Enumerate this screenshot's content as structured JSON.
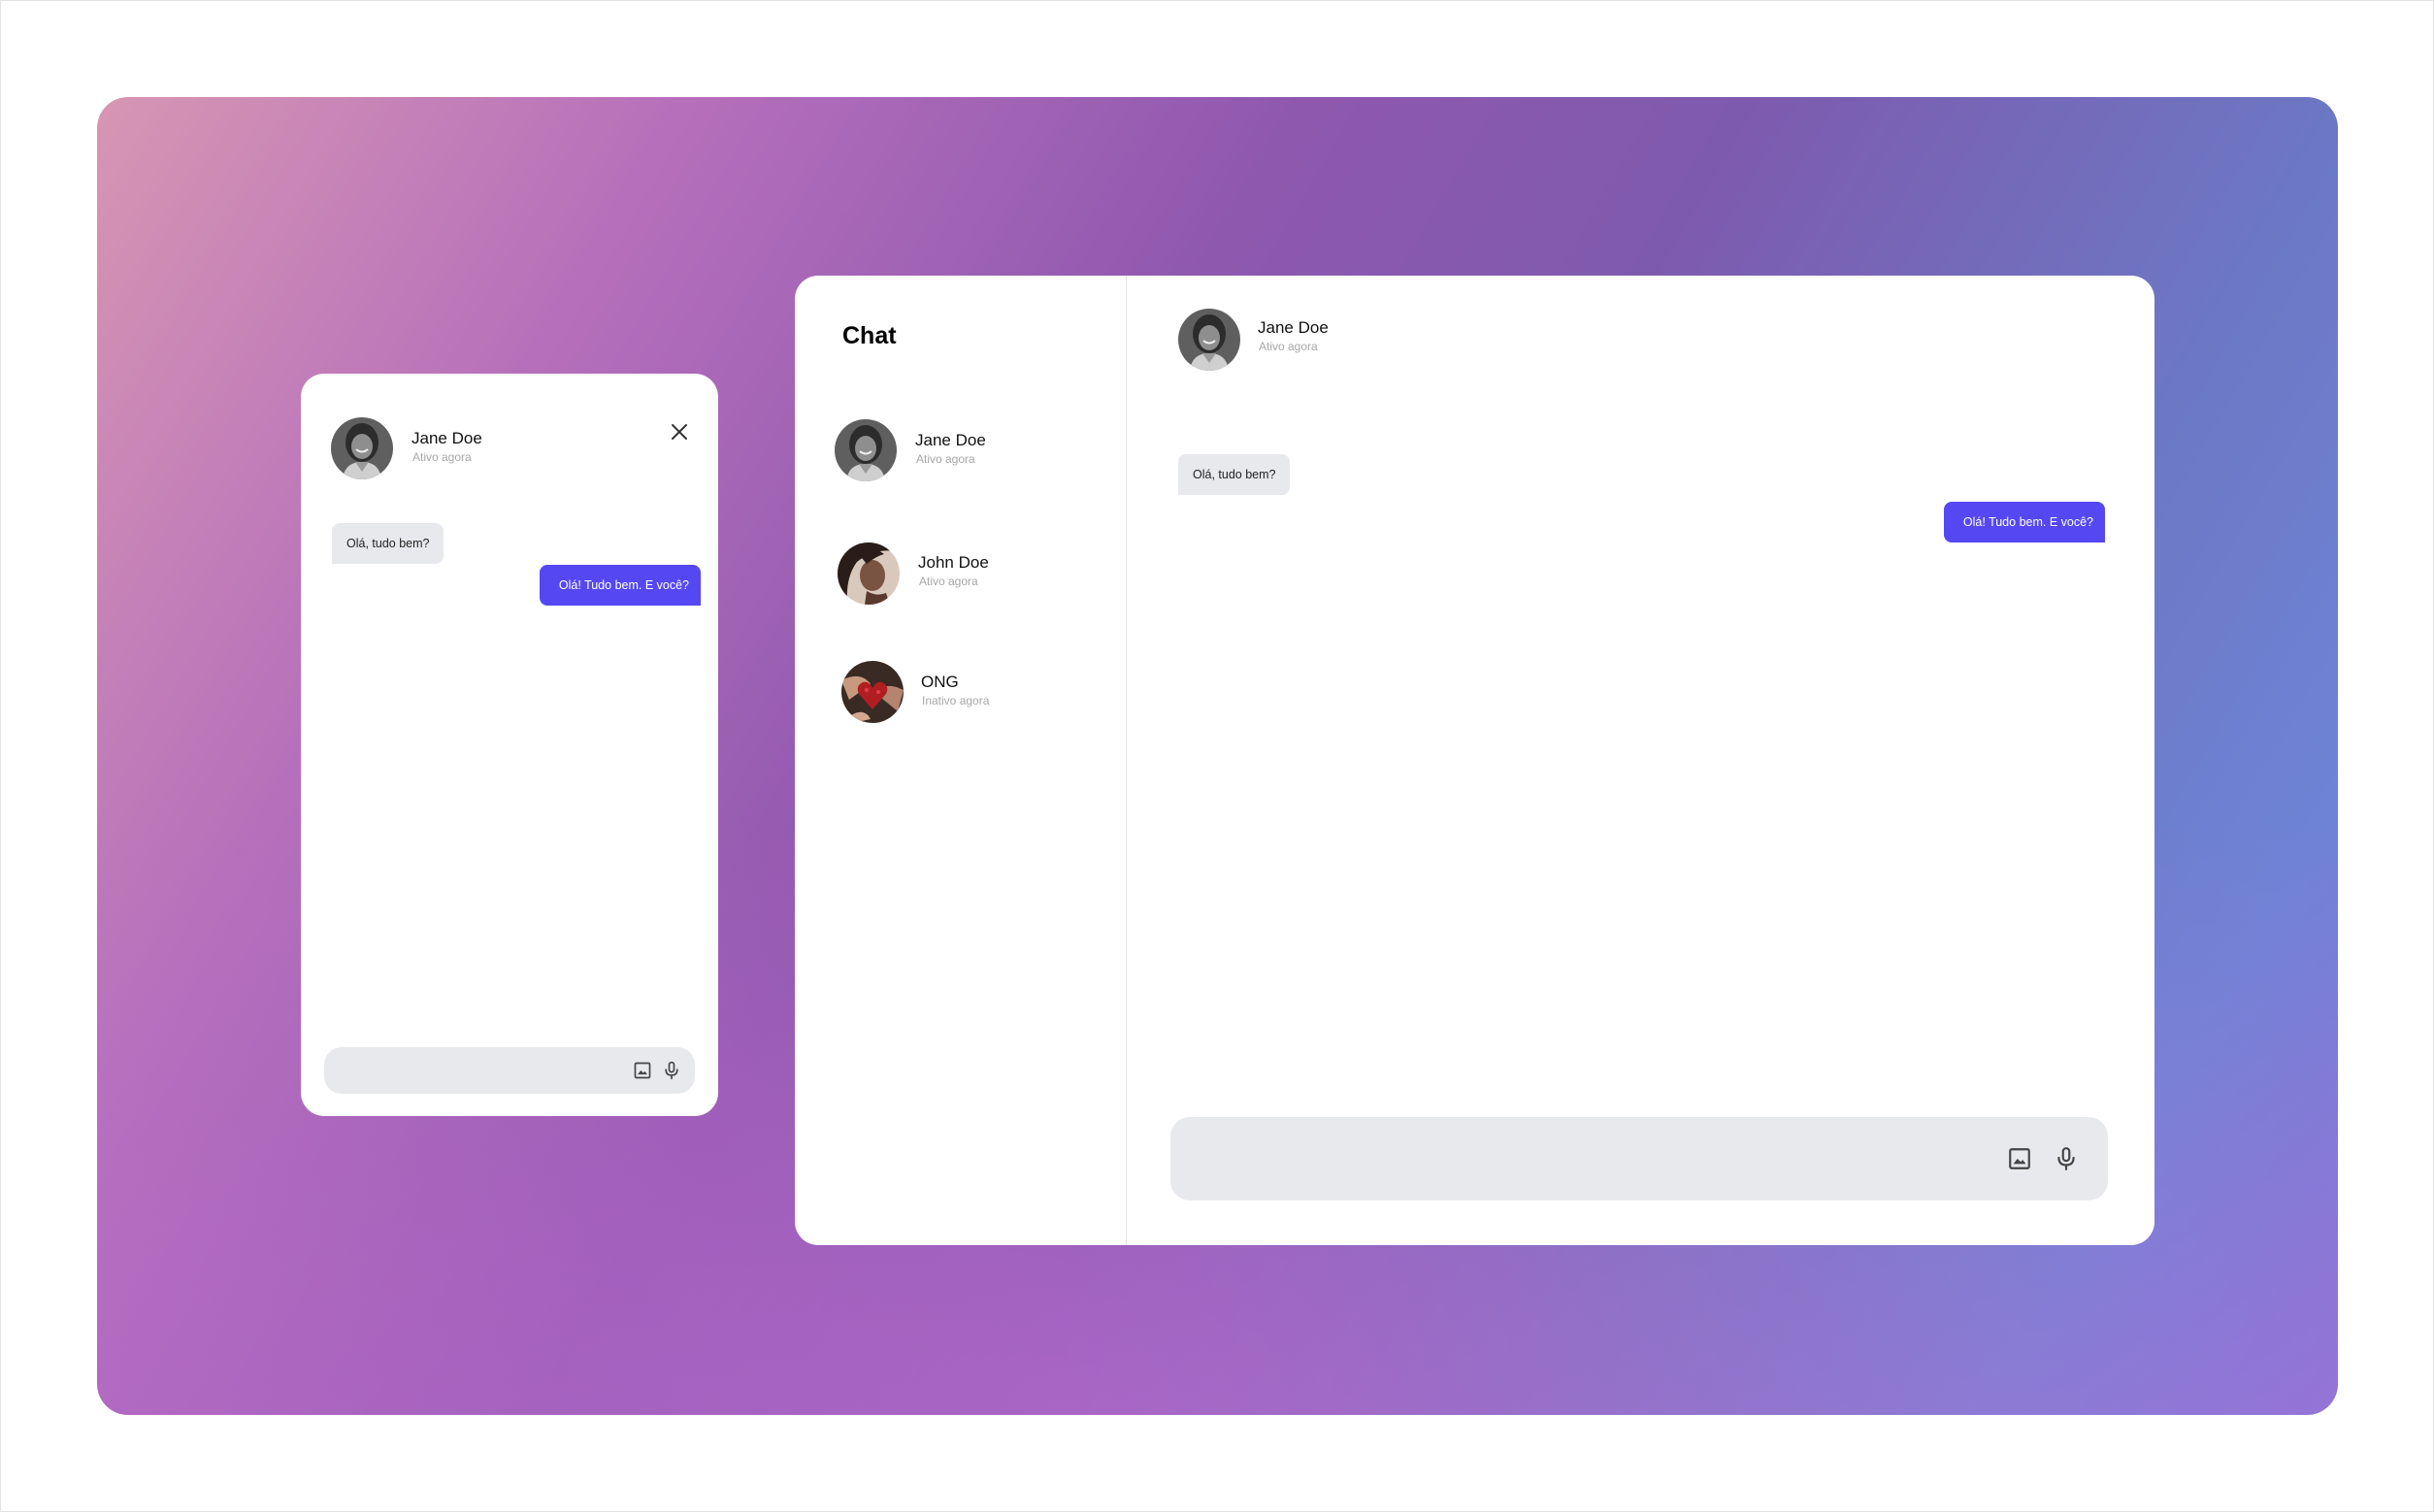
{
  "widget": {
    "contact_name": "Jane Doe",
    "contact_status": "Ativo agora",
    "messages": [
      {
        "direction": "incoming",
        "text": "Olá, tudo bem?"
      },
      {
        "direction": "outgoing",
        "text": "Olá! Tudo bem. E você?"
      }
    ],
    "input_value": "",
    "icons": {
      "close": "close-icon",
      "image": "image-icon",
      "mic": "microphone-icon"
    }
  },
  "sidebar": {
    "title": "Chat",
    "contacts": [
      {
        "name": "Jane Doe",
        "status": "Ativo agora",
        "avatar": "avatar-woman-smiling"
      },
      {
        "name": "John Doe",
        "status": "Ativo agora",
        "avatar": "avatar-woman-profile"
      },
      {
        "name": "ONG",
        "status": "Inativo agora",
        "avatar": "avatar-hands-heart"
      }
    ]
  },
  "conversation": {
    "contact_name": "Jane Doe",
    "contact_status": "Ativo agora",
    "messages": [
      {
        "direction": "incoming",
        "text": "Olá, tudo bem?"
      },
      {
        "direction": "outgoing",
        "text": "Olá! Tudo bem. E você?"
      }
    ],
    "input_value": "",
    "icons": {
      "image": "image-icon",
      "mic": "microphone-icon"
    }
  },
  "colors": {
    "outgoing_bubble": "#5548f3",
    "incoming_bubble": "#e8e9ed",
    "composer": "#e8e9ed",
    "background_gradient": [
      "#d796b3",
      "#8f58af",
      "#6e83d6",
      "#b86cc8"
    ]
  }
}
